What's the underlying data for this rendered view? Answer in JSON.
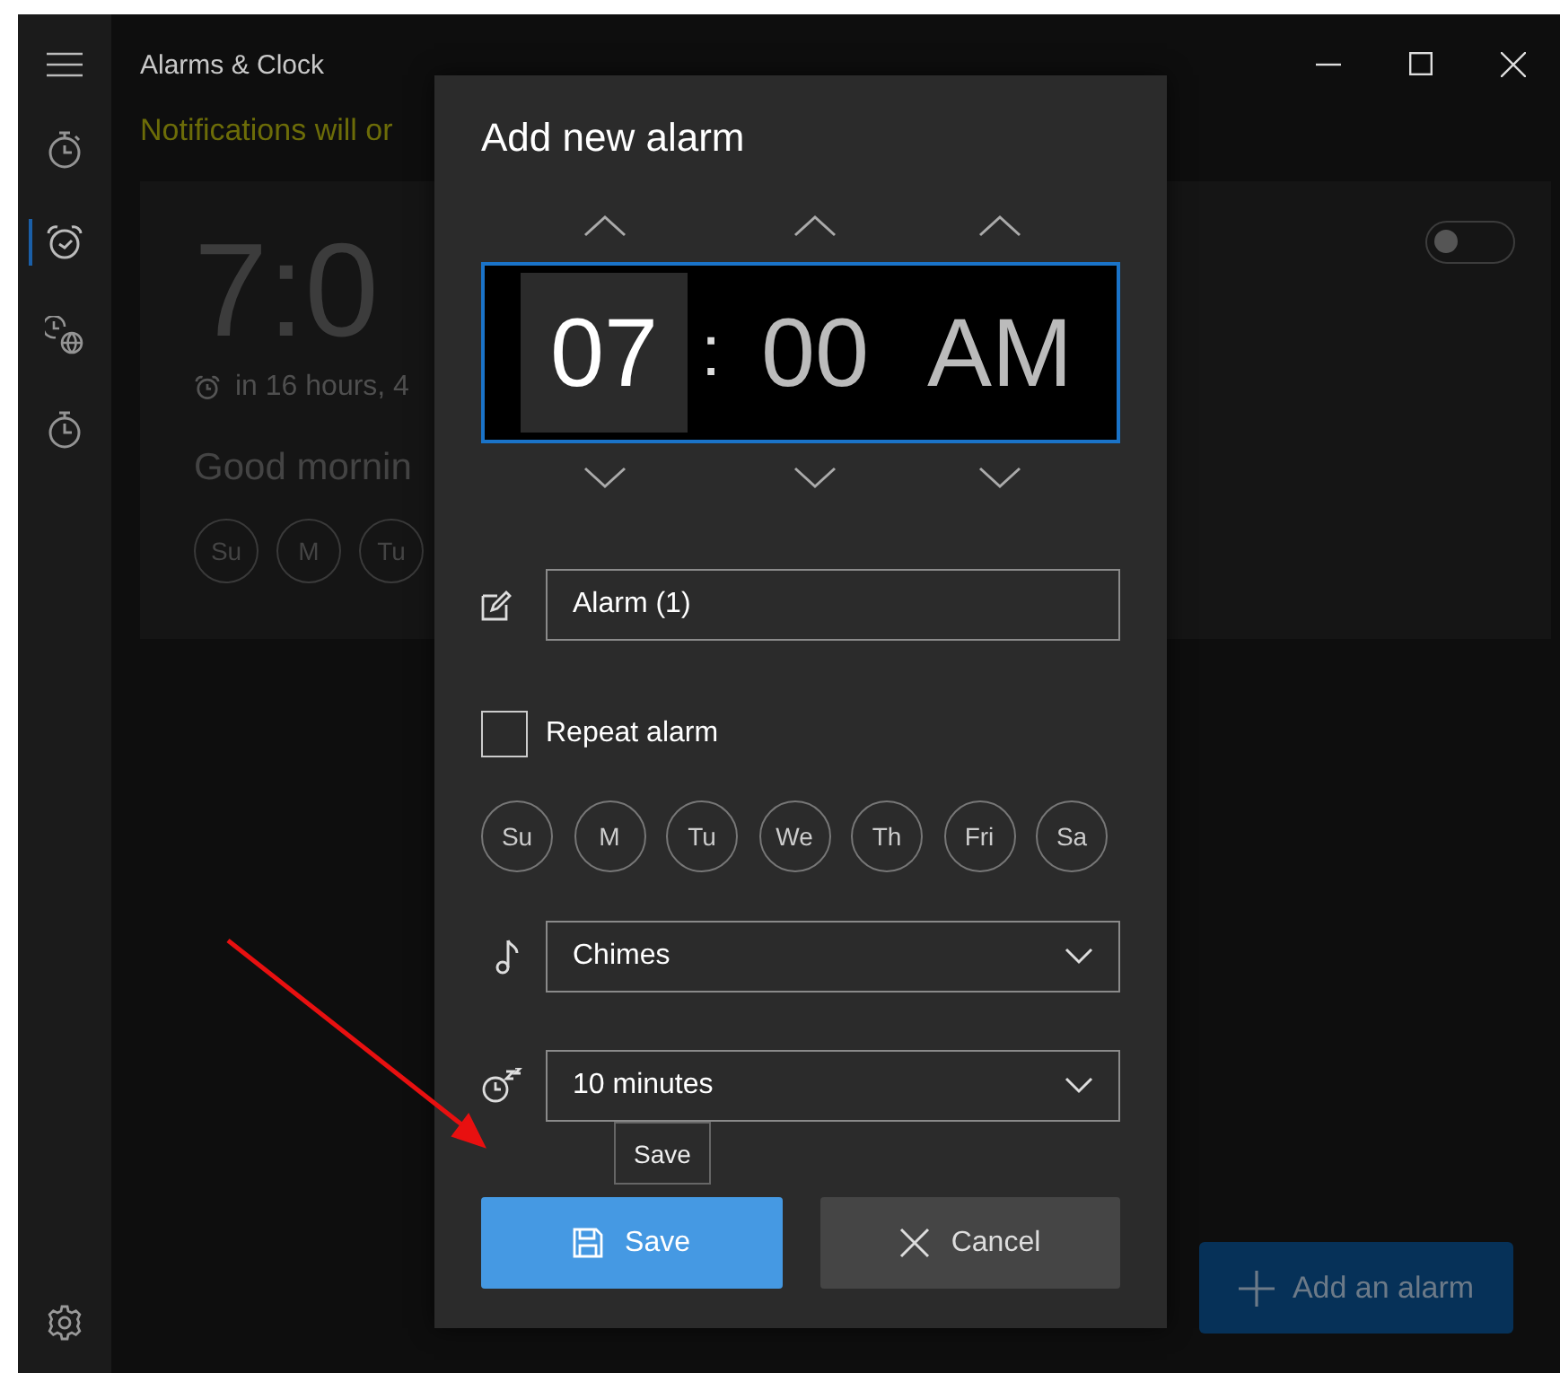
{
  "window": {
    "title": "Alarms & Clock"
  },
  "sidebar": {
    "nav": [
      {
        "kind": "timer",
        "selected": false
      },
      {
        "kind": "alarm",
        "selected": true
      },
      {
        "kind": "world-clock",
        "selected": false
      },
      {
        "kind": "stopwatch",
        "selected": false
      }
    ]
  },
  "notice": "Notifications will or",
  "alarm": {
    "time": "7:0",
    "countdown": "in 16 hours, 4",
    "name": "Good mornin",
    "on": false,
    "days": [
      {
        "label": "Su",
        "selected": false
      },
      {
        "label": "M",
        "selected": false
      },
      {
        "label": "Tu",
        "selected": false
      }
    ]
  },
  "add_button": {
    "label": "Add an alarm"
  },
  "dialog": {
    "title": "Add new alarm",
    "time": {
      "separator": ":",
      "columns": [
        {
          "value": "07",
          "selected": true
        },
        {
          "value": "00",
          "selected": false
        },
        {
          "value": "AM",
          "selected": false
        }
      ]
    },
    "name_field": {
      "value": "Alarm (1)"
    },
    "repeat": {
      "label": "Repeat alarm",
      "checked": false
    },
    "days": [
      {
        "label": "Su",
        "selected": false
      },
      {
        "label": "M",
        "selected": false
      },
      {
        "label": "Tu",
        "selected": false
      },
      {
        "label": "We",
        "selected": false
      },
      {
        "label": "Th",
        "selected": false
      },
      {
        "label": "Fri",
        "selected": false
      },
      {
        "label": "Sa",
        "selected": false
      }
    ],
    "sound": {
      "value": "Chimes"
    },
    "snooze": {
      "value": "10 minutes"
    },
    "buttons": [
      {
        "kind": "save",
        "label": "Save"
      },
      {
        "kind": "cancel",
        "label": "Cancel"
      }
    ],
    "tooltip": "Save"
  }
}
